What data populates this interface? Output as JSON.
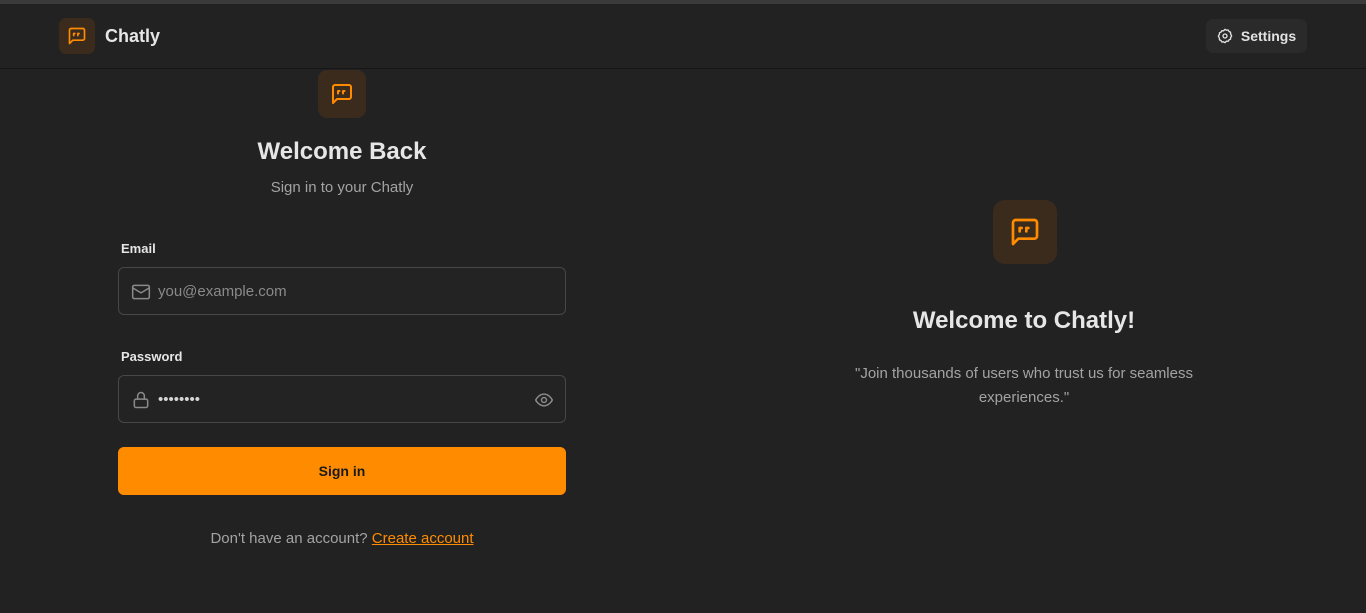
{
  "colors": {
    "accent": "#ff8c00",
    "background": "#222222",
    "logo_bg": "#3b2b1c"
  },
  "navbar": {
    "brand_name": "Chatly",
    "brand_icon": "message-quote-icon",
    "settings_label": "Settings",
    "settings_icon": "gear-icon"
  },
  "form": {
    "logo_icon": "message-quote-icon",
    "title": "Welcome Back",
    "subtitle": "Sign in to your Chatly",
    "email": {
      "label": "Email",
      "placeholder": "you@example.com",
      "value": "",
      "icon": "mail-icon"
    },
    "password": {
      "label": "Password",
      "value": "••••••••",
      "icon": "lock-icon",
      "toggle_icon": "eye-icon"
    },
    "submit_label": "Sign in",
    "footer_prompt": "Don't have an account?",
    "footer_link": "Create account"
  },
  "promo": {
    "logo_icon": "message-quote-icon",
    "title": "Welcome to Chatly!",
    "quote": "\"Join thousands of users who trust us for seamless experiences.\""
  }
}
